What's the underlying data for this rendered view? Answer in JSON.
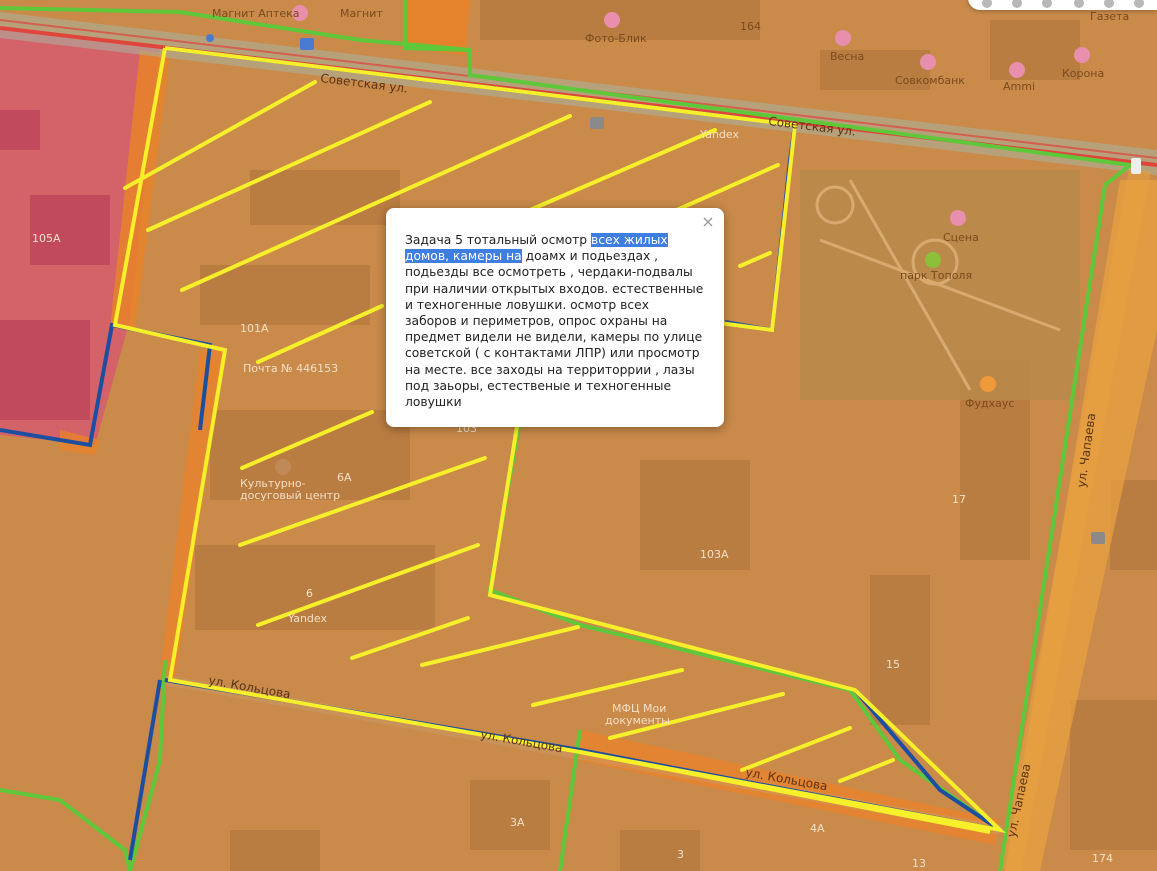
{
  "map": {
    "labels": {
      "magnit_apteka": "Магнит Аптека",
      "magnit": "Магнит",
      "foto_blik": "Фото-Блик",
      "bld_164": "164",
      "vesna": "Весна",
      "sovkombank": "Совкомбанк",
      "ammi": "Ammi",
      "korona": "Корона",
      "gazeta": "Газета",
      "sovetskaya_1": "Советская ул.",
      "sovetskaya_2": "Советская ул.",
      "yandex_1": "Yandex",
      "yandex_2": "Yandex",
      "bld_105a": "105А",
      "bld_101a": "101А",
      "pochta": "Почта № 446153",
      "bld_103": "103",
      "bld_6a": "6А",
      "kdc_1": "Культурно-",
      "kdc_2": "досуговый центр",
      "bld_6": "6",
      "bld_103a": "103А",
      "scena": "Сцена",
      "park": "парк Тополя",
      "fudhaus": "Фудхаус",
      "bld_17": "17",
      "bld_15": "15",
      "chapaeva_1": "ул. Чапаева",
      "chapaeva_2": "ул. Чапаева",
      "mfc_1": "МФЦ Мои",
      "mfc_2": "документы",
      "kolcova_1": "ул. Кольцова",
      "kolcova_2": "ул. Кольцова",
      "kolcova_3": "ул. Кольцова",
      "bld_3a": "3А",
      "bld_3": "3",
      "bld_4a": "4А",
      "bld_13": "13",
      "bld_174": "174"
    },
    "colors": {
      "boundary_yellow": "#f6ef2a",
      "boundary_green": "#5ec83a",
      "boundary_blue": "#1c4fa0",
      "road_red": "#e0453c",
      "zone_pink": "#e0607a",
      "zone_orange": "#e8822a"
    }
  },
  "popup": {
    "text_before": "Задача 5 тотальный осмотр ",
    "text_highlighted": "всех жилых домов, камеры на",
    "text_after": " доамх и подьездах , подьезды все осмотреть , чердаки-подвалы при наличии открытых входов. естественные и техногенные ловушки. осмотр всех заборов и периметров, опрос охраны на предмет видели не видели, камеры по улице советской ( с контактами ЛПР) или просмотр на месте. все заходы на территоррии , лазы под заьоры, естественые и техногенные ловушки",
    "close_label": "×"
  }
}
